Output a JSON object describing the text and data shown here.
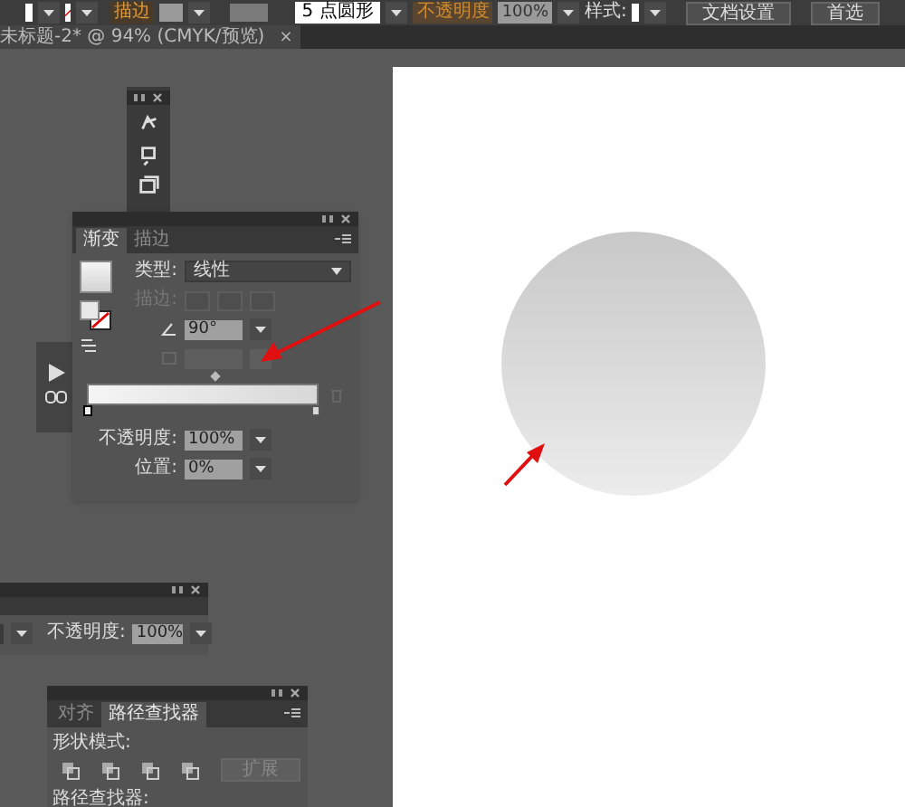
{
  "toolbar": {
    "stroke_label": "描边",
    "brush": "5 点圆形",
    "opacity_label": "不透明度",
    "opacity": "100%",
    "style_label": "样式:",
    "buttons": [
      "文档设置",
      "首选"
    ]
  },
  "document_tab": {
    "title": "未标题-2* @ 94% (CMYK/预览)",
    "close": "×"
  },
  "gradient_panel": {
    "tabs": [
      {
        "label": "渐变",
        "selected": true
      },
      {
        "label": "描边",
        "selected": false
      }
    ],
    "type_label": "类型:",
    "type": "线性",
    "stroke_label": "描边:",
    "stroke_disabled": true,
    "angle": "90°",
    "aspect_disabled": true,
    "stops": [
      {
        "level": 0,
        "selected": true
      },
      {
        "level": 1,
        "selected": false
      }
    ],
    "opacity_label": "不透明度:",
    "opacity": "100%",
    "location_label": "位置:",
    "location": "0%"
  },
  "transparency_panel": {
    "opacity_label": "不透明度:",
    "opacity": "100%"
  },
  "pathfinder_panel": {
    "tabs": [
      {
        "label": "对齐",
        "selected": false
      },
      {
        "label": "路径查找器",
        "selected": true
      }
    ],
    "shape_modes_label": "形状模式:",
    "expand": "扩展",
    "pathfinders_label": "路径查找器:"
  }
}
